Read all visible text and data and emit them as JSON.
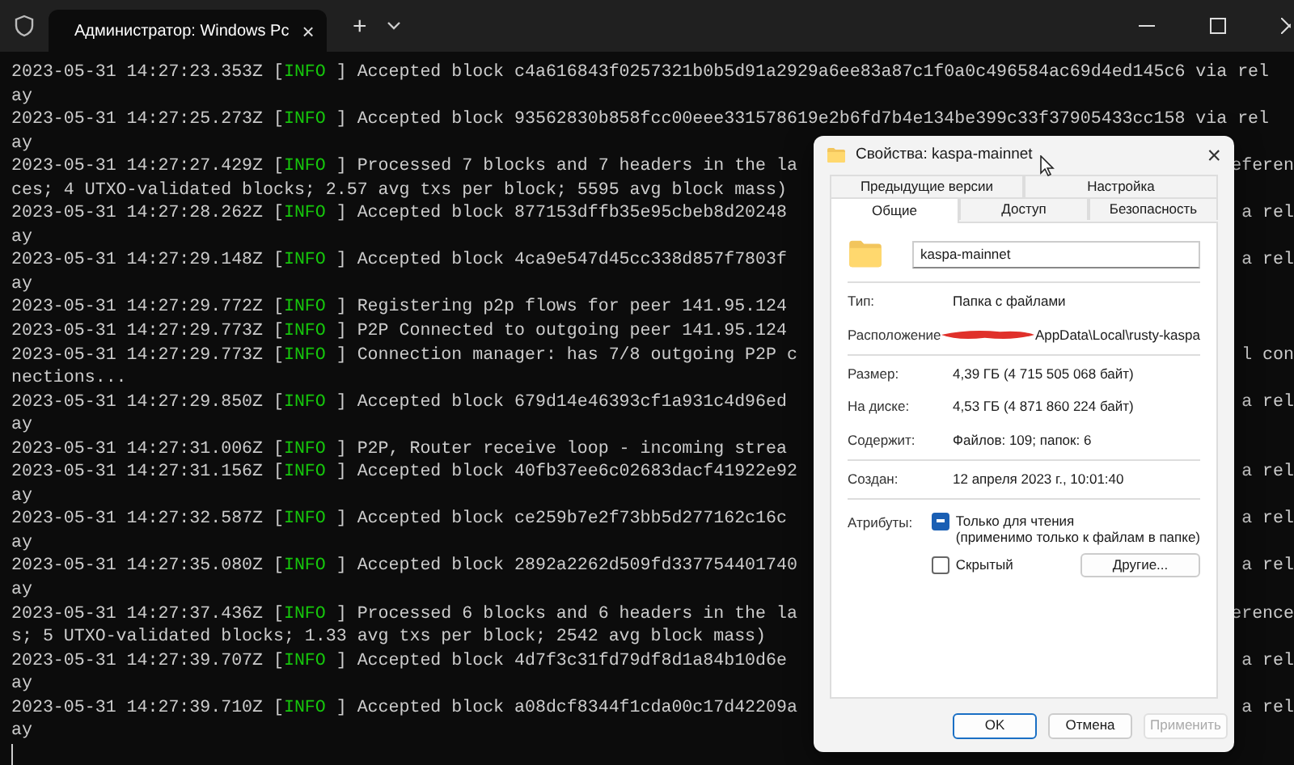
{
  "terminal": {
    "tab_title": "Администратор: Windows Pc",
    "tab_close": "×",
    "new_tab": "+",
    "lines": [
      {
        "time": "2023-05-31 14:27:23.353Z [",
        "level": "INFO",
        "text": " ] Accepted block c4a616843f0257321b0b5d91a2929a6ee83a87c1f0a0c496584ac69d4ed145c6 via rel"
      },
      {
        "text": "ay"
      },
      {
        "time": "2023-05-31 14:27:25.273Z [",
        "level": "INFO",
        "text": " ] Accepted block 93562830b858fcc00eee331578619e2b6fd7b4e134be399c33f37905433cc158 via rel"
      },
      {
        "text": "ay"
      },
      {
        "time": "2023-05-31 14:27:27.429Z [",
        "level": "INFO",
        "text": " ] Processed 7 blocks and 7 headers in the la",
        "tail": "eferen"
      },
      {
        "text": "ces; 4 UTXO-validated blocks; 2.57 avg txs per block; 5595 avg block mass)"
      },
      {
        "time": "2023-05-31 14:27:28.262Z [",
        "level": "INFO",
        "text": " ] Accepted block 877153dffb35e95cbeb8d20248",
        "tail": "a rel"
      },
      {
        "text": "ay"
      },
      {
        "time": "2023-05-31 14:27:29.148Z [",
        "level": "INFO",
        "text": " ] Accepted block 4ca9e547d45cc338d857f7803f",
        "tail": "a rel"
      },
      {
        "text": "ay"
      },
      {
        "time": "2023-05-31 14:27:29.772Z [",
        "level": "INFO",
        "text": " ] Registering p2p flows for peer 141.95.124"
      },
      {
        "time": "2023-05-31 14:27:29.773Z [",
        "level": "INFO",
        "text": " ] P2P Connected to outgoing peer 141.95.124"
      },
      {
        "time": "2023-05-31 14:27:29.773Z [",
        "level": "INFO",
        "text": " ] Connection manager: has 7/8 outgoing P2P c",
        "tail": "l con"
      },
      {
        "text": "nections..."
      },
      {
        "time": "2023-05-31 14:27:29.850Z [",
        "level": "INFO",
        "text": " ] Accepted block 679d14e46393cf1a931c4d96ed",
        "tail": "a rel"
      },
      {
        "text": "ay"
      },
      {
        "time": "2023-05-31 14:27:31.006Z [",
        "level": "INFO",
        "text": " ] P2P, Router receive loop - incoming strea"
      },
      {
        "time": "2023-05-31 14:27:31.156Z [",
        "level": "INFO",
        "text": " ] Accepted block 40fb37ee6c02683dacf41922e92",
        "tail": "a rel"
      },
      {
        "text": "ay"
      },
      {
        "time": "2023-05-31 14:27:32.587Z [",
        "level": "INFO",
        "text": " ] Accepted block ce259b7e2f73bb5d277162c16c",
        "tail": "a rel"
      },
      {
        "text": "ay"
      },
      {
        "time": "2023-05-31 14:27:35.080Z [",
        "level": "INFO",
        "text": " ] Accepted block 2892a2262d509fd337754401740",
        "tail": "a rel"
      },
      {
        "text": "ay"
      },
      {
        "time": "2023-05-31 14:27:37.436Z [",
        "level": "INFO",
        "text": " ] Processed 6 blocks and 6 headers in the la",
        "tail": "erence"
      },
      {
        "text": "s; 5 UTXO-validated blocks; 1.33 avg txs per block; 2542 avg block mass)"
      },
      {
        "time": "2023-05-31 14:27:39.707Z [",
        "level": "INFO",
        "text": " ] Accepted block 4d7f3c31fd79df8d1a84b10d6e",
        "tail": "a rel"
      },
      {
        "text": "ay"
      },
      {
        "time": "2023-05-31 14:27:39.710Z [",
        "level": "INFO",
        "text": " ] Accepted block a08dcf8344f1cda00c17d42209a",
        "tail": "a rel"
      },
      {
        "text": "ay"
      }
    ]
  },
  "dialog": {
    "title": "Свойства: kaspa-mainnet",
    "close": "×",
    "tab_rows": [
      [
        {
          "label": "Предыдущие версии",
          "selected": false
        },
        {
          "label": "Настройка",
          "selected": false
        }
      ],
      [
        {
          "label": "Общие",
          "selected": true
        },
        {
          "label": "Доступ",
          "selected": false
        },
        {
          "label": "Безопасность",
          "selected": false
        }
      ]
    ],
    "name": "kaspa-mainnet",
    "groups": [
      [
        {
          "label": "Тип:",
          "value": "Папка с файлами",
          "redacted": false
        },
        {
          "label": "Расположение",
          "value": "AppData\\Local\\rusty-kaspa",
          "redacted": true
        }
      ],
      [
        {
          "label": "Размер:",
          "value": "4,39 ГБ (4 715 505 068 байт)",
          "redacted": false
        },
        {
          "label": "На диске:",
          "value": "4,53 ГБ (4 871 860 224 байт)",
          "redacted": false
        },
        {
          "label": "Содержит:",
          "value": "Файлов: 109; папок: 6",
          "redacted": false
        }
      ],
      [
        {
          "label": "Создан:",
          "value": "12 апреля 2023 г., 10:01:40",
          "redacted": false
        }
      ]
    ],
    "attributes": {
      "label": "Атрибуты:",
      "readonly": {
        "label": "Только для чтения",
        "note": "(применимо только к файлам в папке)",
        "mixed": true
      },
      "hidden": {
        "label": "Скрытый",
        "checked": false
      },
      "other_button": "Другие..."
    },
    "buttons": [
      {
        "label": "OK",
        "kind": "default",
        "disabled": false
      },
      {
        "label": "Отмена",
        "kind": "normal",
        "disabled": false
      },
      {
        "label": "Применить",
        "kind": "normal",
        "disabled": true
      }
    ]
  }
}
